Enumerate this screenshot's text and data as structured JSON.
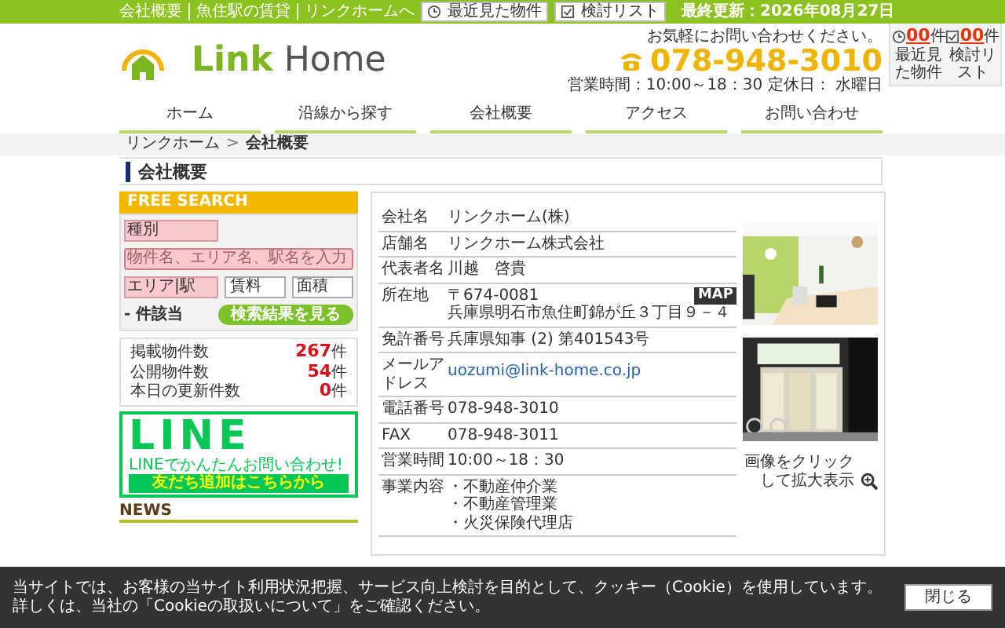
{
  "top_bar": {
    "links": [
      "会社概要",
      "魚住駅の賃貸",
      "リンクホームへ"
    ],
    "buttons": [
      {
        "label": "最近見た物件",
        "kind": "clock"
      },
      {
        "label": "検討リスト",
        "kind": "check"
      }
    ],
    "updated": "最終更新：2026年08月27日"
  },
  "header": {
    "logo": {
      "primary": "Link",
      "secondary": "Home"
    },
    "tagline": "お気軽にお問い合わせください。",
    "phone": "078-948-3010",
    "hours": "営業時間：10:00～18：30 定休日： 水曜日"
  },
  "counter_widget": [
    {
      "count": "00",
      "unit": "件",
      "label": "最近見た物件",
      "kind": "clock"
    },
    {
      "count": "00",
      "unit": "件",
      "label": "検討リスト",
      "kind": "check"
    }
  ],
  "nav": [
    {
      "label": "ホーム",
      "selected": false
    },
    {
      "label": "沿線から探す",
      "selected": false
    },
    {
      "label": "会社概要",
      "selected": false
    },
    {
      "label": "アクセス",
      "selected": false
    },
    {
      "label": "お問い合わせ",
      "selected": false
    }
  ],
  "breadcrumb": [
    {
      "label": "リンクホーム",
      "kind": "link"
    },
    {
      "label": ">",
      "kind": "sep"
    },
    {
      "label": "会社概要",
      "kind": "current"
    }
  ],
  "page_title": "会社概要",
  "search": {
    "title": "FREE SEARCH",
    "type_select": "種別",
    "keyword": {
      "placeholder": "物件名、エリア名、駅名を入力"
    },
    "selects": [
      "エリア|駅",
      "賃料",
      "面積"
    ],
    "hits": "- 件該当",
    "button": "検索結果を見る"
  },
  "stats": [
    {
      "label": "掲載物件数",
      "value": "267",
      "unit": "件"
    },
    {
      "label": "公開物件数",
      "value": "54",
      "unit": "件"
    },
    {
      "label": "本日の更新件数",
      "value": "0",
      "unit": "件"
    }
  ],
  "line_banner": {
    "logo": "LINE",
    "text": "LINEでかんたんお問い合わせ!",
    "button": "友だち追加はこちらから"
  },
  "news": {
    "title": "NEWS"
  },
  "company_table": [
    {
      "label": "会社名",
      "kind": "text",
      "lines": [
        "リンクホーム(株)"
      ]
    },
    {
      "label": "店舗名",
      "kind": "text",
      "lines": [
        "リンクホーム株式会社"
      ]
    },
    {
      "label": "代表者名",
      "kind": "text",
      "lines": [
        "川越　啓貴"
      ]
    },
    {
      "label": "所在地",
      "kind": "address",
      "lines": [
        "〒674-0081",
        "兵庫県明石市魚住町錦が丘３丁目９－４"
      ],
      "map_button": "MAP"
    },
    {
      "label": "免許番号",
      "kind": "text",
      "lines": [
        "兵庫県知事 (2) 第401543号"
      ]
    },
    {
      "label": "メールアドレス",
      "kind": "email",
      "lines": [
        "uozumi@link-home.co.jp"
      ]
    },
    {
      "label": "電話番号",
      "kind": "text",
      "lines": [
        "078-948-3010"
      ]
    },
    {
      "label": "FAX",
      "kind": "text",
      "lines": [
        "078-948-3011"
      ]
    },
    {
      "label": "営業時間",
      "kind": "text",
      "lines": [
        "10:00～18：30"
      ]
    },
    {
      "label": "事業内容",
      "kind": "text",
      "lines": [
        "・不動産仲介業",
        "・不動産管理業",
        "・火災保険代理店"
      ]
    }
  ],
  "photo_caption": "画像をクリックして拡大表示",
  "cookie_banner": {
    "text": "当サイトでは、お客様の当サイト利用状況把握、サービス向上検討を目的として、クッキー（Cookie）を使用しています。",
    "text_2_before": "詳しくは、当社の",
    "link": "「Cookieの取扱いについて」",
    "text_2_after": "をご確認ください。",
    "button": "閉じる"
  }
}
